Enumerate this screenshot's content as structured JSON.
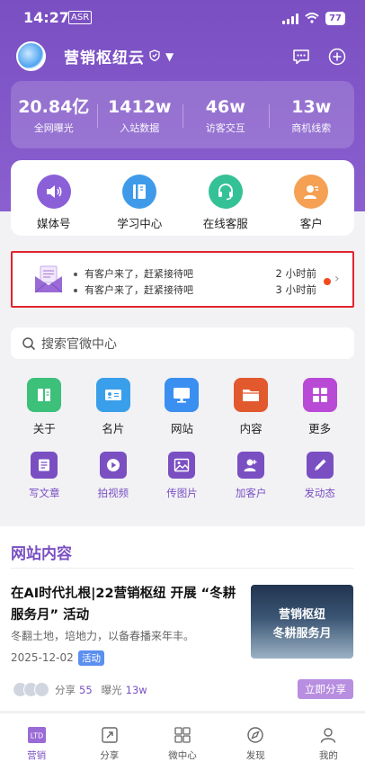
{
  "status": {
    "time": "14:27",
    "tag": "ASR",
    "battery": "77"
  },
  "header": {
    "company": "营销枢纽云"
  },
  "stats": [
    {
      "value": "20.84亿",
      "label": "全网曝光"
    },
    {
      "value": "1412w",
      "label": "入站数据"
    },
    {
      "value": "46w",
      "label": "访客交互"
    },
    {
      "value": "13w",
      "label": "商机线索"
    }
  ],
  "quick": [
    {
      "label": "媒体号",
      "icon": "speaker-icon",
      "color": "#8a5fd8"
    },
    {
      "label": "学习中心",
      "icon": "book-icon",
      "color": "#3f9bea"
    },
    {
      "label": "在线客服",
      "icon": "headset-icon",
      "color": "#35c196"
    },
    {
      "label": "客户",
      "icon": "customer-icon",
      "color": "#f5a053"
    }
  ],
  "notify": {
    "items": [
      {
        "text": "有客户来了，赶紧接待吧",
        "time": "2 小时前"
      },
      {
        "text": "有客户来了，赶紧接待吧",
        "time": "3 小时前"
      }
    ]
  },
  "search": {
    "placeholder": "搜索官微中心"
  },
  "apps": [
    {
      "label": "关于",
      "icon": "about-icon",
      "color": "#3cc07a"
    },
    {
      "label": "名片",
      "icon": "card-icon",
      "color": "#3a9fea"
    },
    {
      "label": "网站",
      "icon": "monitor-icon",
      "color": "#3a8ff0"
    },
    {
      "label": "内容",
      "icon": "folder-icon",
      "color": "#e2592e"
    },
    {
      "label": "更多",
      "icon": "more-icon",
      "color": "#b84ad6"
    }
  ],
  "actions": [
    {
      "label": "写文章",
      "icon": "article-icon"
    },
    {
      "label": "拍视频",
      "icon": "video-icon"
    },
    {
      "label": "传图片",
      "icon": "image-icon"
    },
    {
      "label": "加客户",
      "icon": "add-user-icon"
    },
    {
      "label": "发动态",
      "icon": "post-icon"
    }
  ],
  "section": {
    "title": "网站内容"
  },
  "article": {
    "title": "在AI时代扎根|22营销枢纽 开展 “冬耕服务月” 活动",
    "subtitle": "冬翻土地，培地力，以备春播来年丰。",
    "date": "2025-12-02",
    "tag": "活动",
    "thumb_line1": "营销枢纽",
    "thumb_line2": "冬耕服务月",
    "share_label": "分享",
    "share_count": "55",
    "view_label": "曝光",
    "view_count": "13w",
    "share_button": "立即分享"
  },
  "tabs": [
    {
      "label": "营销",
      "icon": "ltd-icon",
      "active": true
    },
    {
      "label": "分享",
      "icon": "share-icon"
    },
    {
      "label": "微中心",
      "icon": "grid-icon"
    },
    {
      "label": "发现",
      "icon": "compass-icon"
    },
    {
      "label": "我的",
      "icon": "user-icon"
    }
  ],
  "colors": {
    "brand": "#7a4fc2",
    "alert": "#e0242e"
  }
}
